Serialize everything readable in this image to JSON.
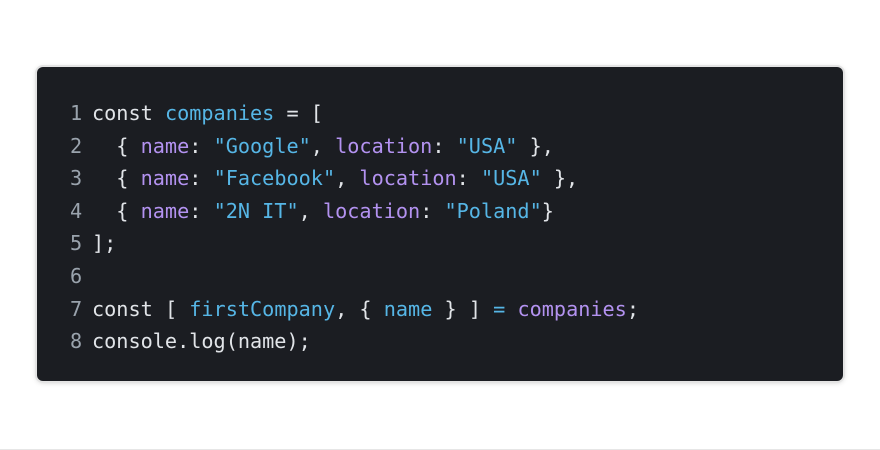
{
  "code_block": {
    "language": "javascript",
    "theme": {
      "background": "#1b1d22",
      "default_text": "#e1e4e8",
      "line_number": "#9aa3ad",
      "identifier_blue": "#56b6e6",
      "property_purple": "#b392f0"
    },
    "lines": [
      {
        "number": "1",
        "tokens": [
          {
            "t": "kw",
            "v": "const "
          },
          {
            "t": "var",
            "v": "companies"
          },
          {
            "t": "punc",
            "v": " = ["
          }
        ]
      },
      {
        "number": "2",
        "tokens": [
          {
            "t": "punc",
            "v": "  { "
          },
          {
            "t": "prop",
            "v": "name"
          },
          {
            "t": "punc",
            "v": ": "
          },
          {
            "t": "str",
            "v": "\"Google\""
          },
          {
            "t": "punc",
            "v": ", "
          },
          {
            "t": "prop",
            "v": "location"
          },
          {
            "t": "punc",
            "v": ": "
          },
          {
            "t": "str",
            "v": "\"USA\""
          },
          {
            "t": "punc",
            "v": " },"
          }
        ]
      },
      {
        "number": "3",
        "tokens": [
          {
            "t": "punc",
            "v": "  { "
          },
          {
            "t": "prop",
            "v": "name"
          },
          {
            "t": "punc",
            "v": ": "
          },
          {
            "t": "str",
            "v": "\"Facebook\""
          },
          {
            "t": "punc",
            "v": ", "
          },
          {
            "t": "prop",
            "v": "location"
          },
          {
            "t": "punc",
            "v": ": "
          },
          {
            "t": "str",
            "v": "\"USA\""
          },
          {
            "t": "punc",
            "v": " },"
          }
        ]
      },
      {
        "number": "4",
        "tokens": [
          {
            "t": "punc",
            "v": "  { "
          },
          {
            "t": "prop",
            "v": "name"
          },
          {
            "t": "punc",
            "v": ": "
          },
          {
            "t": "str",
            "v": "\"2N IT\""
          },
          {
            "t": "punc",
            "v": ", "
          },
          {
            "t": "prop",
            "v": "location"
          },
          {
            "t": "punc",
            "v": ": "
          },
          {
            "t": "str",
            "v": "\"Poland\""
          },
          {
            "t": "punc",
            "v": "}"
          }
        ]
      },
      {
        "number": "5",
        "tokens": [
          {
            "t": "punc",
            "v": "];"
          }
        ]
      },
      {
        "number": "6",
        "tokens": []
      },
      {
        "number": "7",
        "tokens": [
          {
            "t": "kw",
            "v": "const "
          },
          {
            "t": "punc",
            "v": "[ "
          },
          {
            "t": "var",
            "v": "firstCompany"
          },
          {
            "t": "punc",
            "v": ", { "
          },
          {
            "t": "var",
            "v": "name"
          },
          {
            "t": "punc",
            "v": " } ] "
          },
          {
            "t": "var",
            "v": "="
          },
          {
            "t": "punc",
            "v": " "
          },
          {
            "t": "fn",
            "v": "companies"
          },
          {
            "t": "punc",
            "v": ";"
          }
        ]
      },
      {
        "number": "8",
        "tokens": [
          {
            "t": "punc",
            "v": "console.log(name);"
          }
        ]
      }
    ]
  }
}
